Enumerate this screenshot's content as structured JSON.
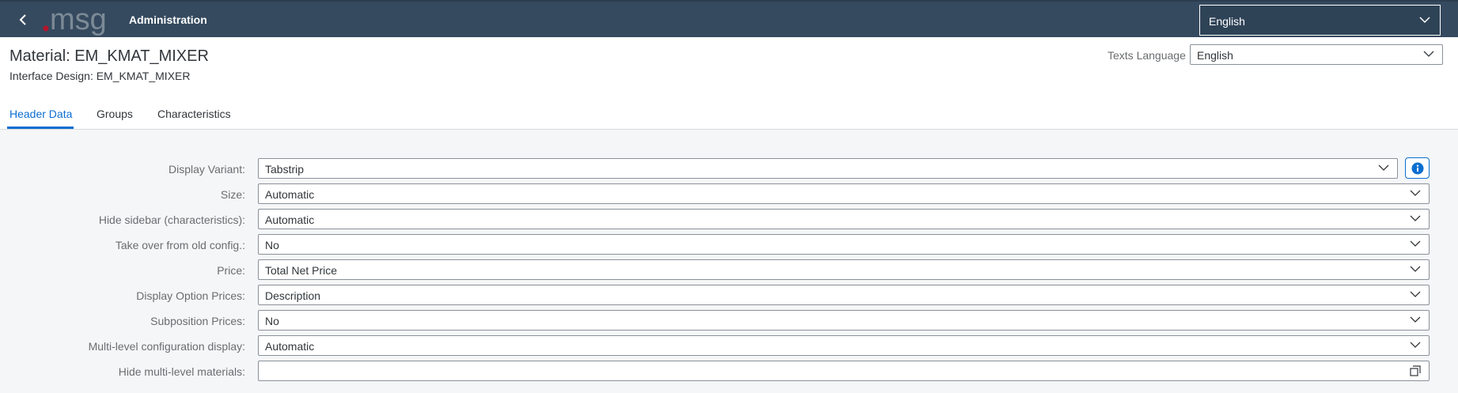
{
  "shell": {
    "logo_text": "msg",
    "title": "Administration",
    "language_select": "English",
    "accent": "#354a5f",
    "logo_dot_color": "#b5152b"
  },
  "header": {
    "title": "Material: EM_KMAT_MIXER",
    "subtitle": "Interface Design: EM_KMAT_MIXER",
    "texts_language_label": "Texts Language",
    "texts_language_value": "English"
  },
  "tabs": [
    {
      "label": "Header Data",
      "active": true
    },
    {
      "label": "Groups",
      "active": false
    },
    {
      "label": "Characteristics",
      "active": false
    }
  ],
  "form": {
    "rows": [
      {
        "label": "Display Variant:",
        "value": "Tabstrip"
      },
      {
        "label": "Size:",
        "value": "Automatic"
      },
      {
        "label": "Hide sidebar (characteristics):",
        "value": "Automatic"
      },
      {
        "label": "Take over from old config.:",
        "value": "No"
      },
      {
        "label": "Price:",
        "value": "Total Net Price"
      },
      {
        "label": "Display Option Prices:",
        "value": "Description"
      },
      {
        "label": "Subposition Prices:",
        "value": "No"
      },
      {
        "label": "Multi-level configuration display:",
        "value": "Automatic"
      },
      {
        "label": "Hide multi-level materials:",
        "value": ""
      }
    ]
  }
}
